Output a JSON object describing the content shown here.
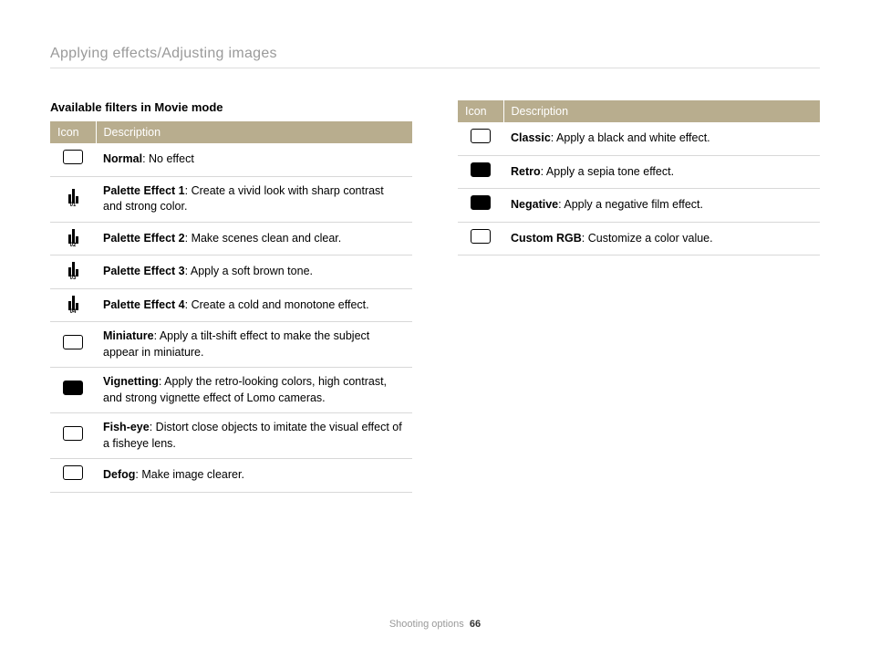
{
  "breadcrumb": "Applying effects/Adjusting images",
  "subheading": "Available filters in Movie mode",
  "table_headers": {
    "icon": "Icon",
    "description": "Description"
  },
  "left_rows": [
    {
      "icon": "normal-off-icon",
      "name": "Normal",
      "desc": ": No effect"
    },
    {
      "icon": "palette-1-icon",
      "name": "Palette Effect 1",
      "desc": ": Create a vivid look with sharp contrast and strong color."
    },
    {
      "icon": "palette-2-icon",
      "name": "Palette Effect 2",
      "desc": ": Make scenes clean and clear."
    },
    {
      "icon": "palette-3-icon",
      "name": "Palette Effect 3",
      "desc": ": Apply a soft brown tone."
    },
    {
      "icon": "palette-4-icon",
      "name": "Palette Effect 4",
      "desc": ": Create a cold and monotone effect."
    },
    {
      "icon": "miniature-icon",
      "name": "Miniature",
      "desc": ": Apply a tilt-shift effect to make the subject appear in miniature."
    },
    {
      "icon": "vignetting-icon",
      "name": "Vignetting",
      "desc": ": Apply the retro-looking colors, high contrast, and strong vignette effect of Lomo cameras."
    },
    {
      "icon": "fish-eye-icon",
      "name": "Fish-eye",
      "desc": ": Distort close objects to imitate the visual effect of a fisheye lens."
    },
    {
      "icon": "defog-icon",
      "name": "Defog",
      "desc": ": Make image clearer."
    }
  ],
  "right_rows": [
    {
      "icon": "classic-icon",
      "name": "Classic",
      "desc": ": Apply a black and white effect."
    },
    {
      "icon": "retro-icon",
      "name": "Retro",
      "desc": ": Apply a sepia tone effect."
    },
    {
      "icon": "negative-icon",
      "name": "Negative",
      "desc": ": Apply a negative film effect."
    },
    {
      "icon": "custom-rgb-icon",
      "name": "Custom RGB",
      "desc": ": Customize a color value."
    }
  ],
  "footer": {
    "section": "Shooting options",
    "page": "66"
  }
}
